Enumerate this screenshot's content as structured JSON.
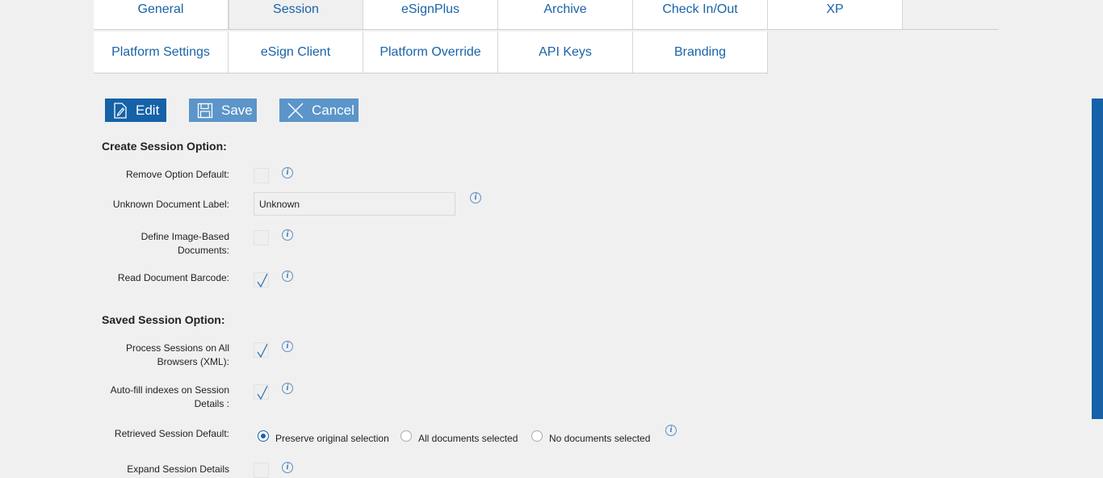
{
  "tabs_row1": [
    "General",
    "Session",
    "eSignPlus",
    "Archive",
    "Check In/Out",
    "XP"
  ],
  "tabs_row2": [
    "Platform Settings",
    "eSign Client",
    "Platform Override",
    "API Keys",
    "Branding"
  ],
  "toolbar": {
    "edit_label": "Edit",
    "save_label": "Save",
    "cancel_label": "Cancel"
  },
  "create_section": {
    "title": "Create Session Option:",
    "remove_option_default": {
      "label": "Remove Option Default:",
      "checked": false
    },
    "unknown_document_label": {
      "label": "Unknown Document Label:",
      "value": "Unknown"
    },
    "define_image_based": {
      "label": "Define Image-Based Documents:",
      "checked": false
    },
    "read_document_barcode": {
      "label": "Read Document Barcode:",
      "checked": true
    }
  },
  "saved_section": {
    "title": "Saved Session Option:",
    "process_sessions": {
      "label": "Process Sessions on All Browsers (XML):",
      "checked": true
    },
    "auto_fill": {
      "label": "Auto-fill indexes on Session Details :",
      "checked": true
    },
    "retrieved_session_default": {
      "label": "Retrieved Session Default:",
      "options": [
        "Preserve original selection",
        "All documents selected",
        "No documents selected"
      ],
      "selected": "Preserve original selection"
    },
    "expand_session_details": {
      "label": "Expand Session Details",
      "checked": false
    }
  },
  "info_icon_glyph": "i",
  "colors": {
    "accent": "#1562a8",
    "button_light": "#5b95c9",
    "tab_text": "#1a63a8"
  }
}
